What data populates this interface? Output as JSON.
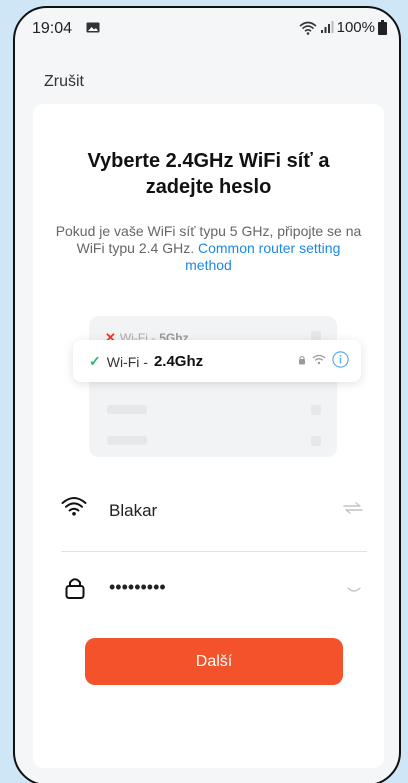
{
  "status_bar": {
    "time": "19:04",
    "battery_text": "100%",
    "icons": [
      "gallery-icon",
      "wifi-signal-icon",
      "cell-signal-icon",
      "battery-icon"
    ]
  },
  "header": {
    "cancel_label": "Zrušit"
  },
  "main": {
    "title": "Vyberte 2.4GHz WiFi síť a zadejte heslo",
    "subtitle_text": "Pokud je vaše WiFi síť typu 5 GHz, připojte se na WiFi typu 2.4 GHz. ",
    "subtitle_link": "Common router setting method"
  },
  "illustration": {
    "network_5g_prefix": "Wi-Fi - ",
    "network_5g_band": "5Ghz",
    "network_24_prefix": "Wi-Fi - ",
    "network_24_band": "2.4Ghz"
  },
  "form": {
    "ssid_value": "Blakar",
    "password_value": "•••••••••"
  },
  "actions": {
    "next_label": "Další"
  },
  "colors": {
    "accent": "#f4522a",
    "link": "#1e88e5",
    "success": "#2bb673",
    "error": "#e53935",
    "background": "#cfe6f6"
  }
}
